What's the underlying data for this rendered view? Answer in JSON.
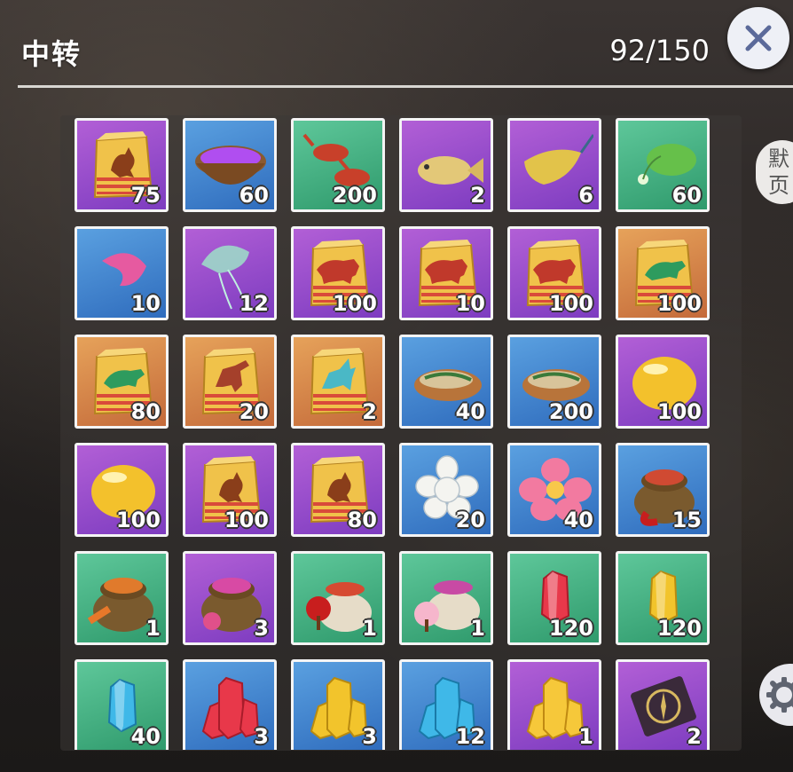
{
  "header": {
    "title": "中转",
    "capacity": "92/150"
  },
  "side_button": {
    "label": "默\n页"
  },
  "colors": {
    "purple": "#9a4cd0",
    "blue": "#3f84d0",
    "green": "#40b080",
    "orange": "#d98548"
  },
  "items": [
    {
      "icon": "feed-bag-bird-icon",
      "bg": "purple",
      "qty": "75"
    },
    {
      "icon": "berry-bowl-icon",
      "bg": "blue",
      "qty": "60"
    },
    {
      "icon": "crayfish-icon",
      "bg": "green",
      "qty": "200"
    },
    {
      "icon": "glowing-fish-icon",
      "bg": "purple",
      "qty": "2"
    },
    {
      "icon": "stingray-icon",
      "bg": "purple",
      "qty": "6"
    },
    {
      "icon": "anglerfish-icon",
      "bg": "green",
      "qty": "60"
    },
    {
      "icon": "pink-shrimp-icon",
      "bg": "blue",
      "qty": "10"
    },
    {
      "icon": "jellyfish-icon",
      "bg": "purple",
      "qty": "12"
    },
    {
      "icon": "feed-bag-boar-icon",
      "bg": "purple",
      "qty": "100"
    },
    {
      "icon": "feed-bag-boar-icon",
      "bg": "purple",
      "qty": "10"
    },
    {
      "icon": "feed-bag-boar-icon",
      "bg": "purple",
      "qty": "100"
    },
    {
      "icon": "feed-bag-turtle-icon",
      "bg": "orange",
      "qty": "100"
    },
    {
      "icon": "feed-bag-turtle-icon",
      "bg": "orange",
      "qty": "80"
    },
    {
      "icon": "feed-bag-dino-icon",
      "bg": "orange",
      "qty": "20"
    },
    {
      "icon": "feed-bag-unicorn-icon",
      "bg": "orange",
      "qty": "2"
    },
    {
      "icon": "cooked-fish-plate-icon",
      "bg": "blue",
      "qty": "40"
    },
    {
      "icon": "cooked-fish-plate-icon",
      "bg": "blue",
      "qty": "200"
    },
    {
      "icon": "golden-bean-icon",
      "bg": "purple",
      "qty": "100"
    },
    {
      "icon": "golden-bean-icon",
      "bg": "purple",
      "qty": "100"
    },
    {
      "icon": "feed-bag-bird-icon",
      "bg": "purple",
      "qty": "100"
    },
    {
      "icon": "feed-bag-bird-icon",
      "bg": "purple",
      "qty": "80"
    },
    {
      "icon": "white-flower-icon",
      "bg": "blue",
      "qty": "20"
    },
    {
      "icon": "pink-flower-icon",
      "bg": "blue",
      "qty": "40"
    },
    {
      "icon": "seed-sack-chili-icon",
      "bg": "blue",
      "qty": "15"
    },
    {
      "icon": "seed-sack-carrot-icon",
      "bg": "green",
      "qty": "1"
    },
    {
      "icon": "seed-sack-lotus-icon",
      "bg": "purple",
      "qty": "3"
    },
    {
      "icon": "seed-sack-red-tree-icon",
      "bg": "green",
      "qty": "1"
    },
    {
      "icon": "seed-sack-sakura-icon",
      "bg": "green",
      "qty": "1"
    },
    {
      "icon": "red-crystal-icon",
      "bg": "green",
      "qty": "120"
    },
    {
      "icon": "yellow-crystal-icon",
      "bg": "green",
      "qty": "120"
    },
    {
      "icon": "blue-crystal-icon",
      "bg": "green",
      "qty": "40"
    },
    {
      "icon": "red-crystal-cluster-icon",
      "bg": "blue",
      "qty": "3"
    },
    {
      "icon": "yellow-crystal-cluster-icon",
      "bg": "blue",
      "qty": "3"
    },
    {
      "icon": "blue-crystal-cluster-icon",
      "bg": "blue",
      "qty": "12"
    },
    {
      "icon": "golden-crystal-cluster-icon",
      "bg": "purple",
      "qty": "1"
    },
    {
      "icon": "scroll-compass-icon",
      "bg": "purple",
      "qty": "2"
    }
  ]
}
